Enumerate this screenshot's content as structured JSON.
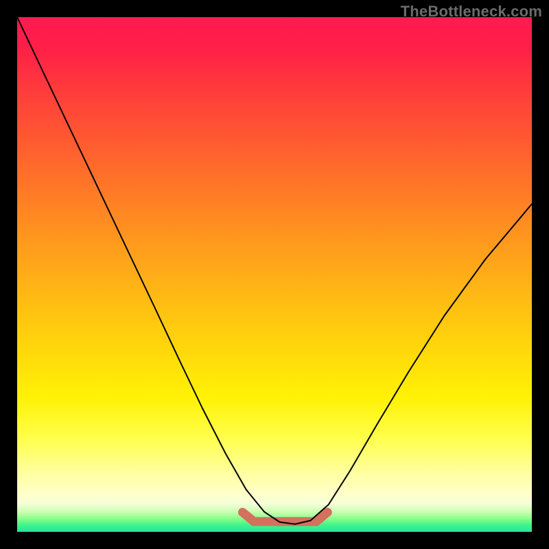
{
  "watermark": "TheBottleneck.com",
  "colors": {
    "frame_background": "#000000",
    "curve_stroke": "#000000",
    "band_stroke": "#d4705e",
    "watermark_text": "#6b6b6b",
    "gradient_stops": [
      "#ff1a50",
      "#ff1f48",
      "#ff3b3b",
      "#ff5a30",
      "#ff7a26",
      "#ff9a1d",
      "#ffb914",
      "#ffd60b",
      "#fff205",
      "#ffff4e",
      "#ffff9a",
      "#ffffc8",
      "#f6ffda",
      "#cfffb4",
      "#8cff8c",
      "#44f58a",
      "#1ee8a0"
    ]
  },
  "chart_data": {
    "type": "line",
    "title": "",
    "xlabel": "",
    "ylabel": "",
    "xlim": [
      0,
      1
    ],
    "ylim": [
      0,
      1
    ],
    "grid": false,
    "legend": false,
    "series": [
      {
        "name": "curve",
        "x": [
          0.0,
          0.045,
          0.09,
          0.135,
          0.18,
          0.225,
          0.27,
          0.315,
          0.36,
          0.405,
          0.445,
          0.48,
          0.51,
          0.54,
          0.57,
          0.605,
          0.647,
          0.7,
          0.76,
          0.83,
          0.91,
          1.0
        ],
        "y": [
          1.0,
          0.905,
          0.81,
          0.715,
          0.62,
          0.525,
          0.43,
          0.334,
          0.24,
          0.152,
          0.082,
          0.039,
          0.019,
          0.015,
          0.022,
          0.053,
          0.119,
          0.21,
          0.31,
          0.42,
          0.53,
          0.637
        ]
      }
    ],
    "annotations": [
      {
        "name": "floor-band",
        "description": "thick salmon horizontal segment along the curve minimum",
        "x_start": 0.438,
        "x_end": 0.603,
        "y": 0.02
      }
    ]
  }
}
